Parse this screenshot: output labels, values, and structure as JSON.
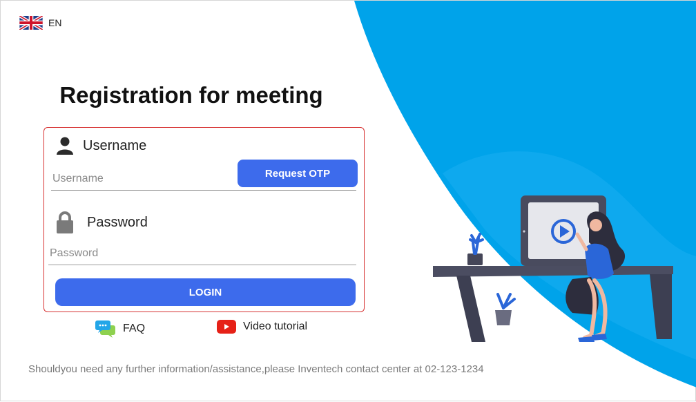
{
  "lang": {
    "code": "EN",
    "flag_icon": "uk-flag-icon"
  },
  "title": "Registration for meeting",
  "form": {
    "username_label": "Username",
    "username_placeholder": "Username",
    "username_value": "",
    "request_otp_label": "Request OTP",
    "password_label": "Password",
    "password_placeholder": "Password",
    "password_value": "",
    "login_label": "LOGIN",
    "border_color": "#d62f2f"
  },
  "links": {
    "faq_label": "FAQ",
    "faq_icon": "chat-bubbles-icon",
    "video_label": "Video tutorial",
    "video_icon": "youtube-icon"
  },
  "footer_text": "Shouldyou need any further information/assistance,please Inventech contact center at 02-123-1234",
  "colors": {
    "accent": "#3d6bec",
    "hero_blue": "#00a3ea",
    "error_border": "#d62f2f"
  }
}
